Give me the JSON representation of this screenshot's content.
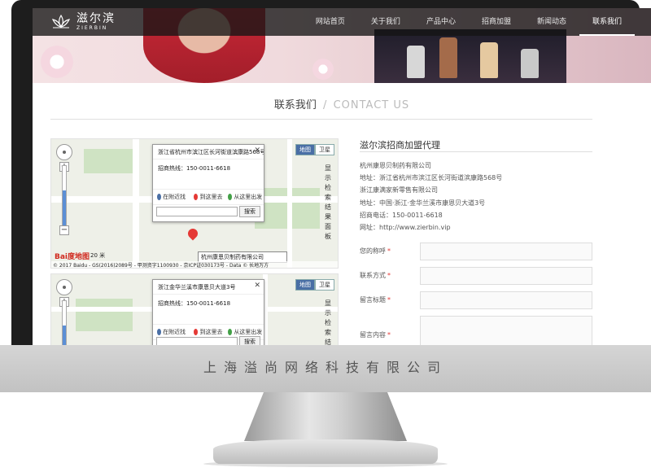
{
  "brand": {
    "name_cn": "滋尔滨",
    "name_en": "ZIERBIN"
  },
  "nav": {
    "items": [
      {
        "label": "网站首页"
      },
      {
        "label": "关于我们"
      },
      {
        "label": "产品中心"
      },
      {
        "label": "招商加盟"
      },
      {
        "label": "新闻动态"
      },
      {
        "label": "联系我们"
      }
    ],
    "active_index": 5
  },
  "section": {
    "title_cn": "联系我们",
    "separator": "/",
    "title_en": "CONTACT US"
  },
  "maps": [
    {
      "address": "浙江省杭州市滨江区长河街道滨康路568号",
      "tel": "招商热线：150-0011-6618",
      "actions": [
        "在附近找",
        "到这里去",
        "从这里出发"
      ],
      "search_button": "搜索",
      "map_types": [
        "地图",
        "卫星"
      ],
      "result_vertical": "显示检索结果面板",
      "pin_label": "杭州康恩贝制药有限公司",
      "baidu_logo": "Bai度地图",
      "scale": "20 米",
      "copyright": "© 2017 Baidu - GS(2016)2089号 - 甲测资字1100930 - 京ICP证030173号 - Data © 长地万方",
      "zoom_level": 0.6
    },
    {
      "address": "浙江金华兰溪市康恩贝大道3号",
      "tel": "招商热线：150-0011-6618",
      "actions": [
        "在附近找",
        "到这里去",
        "从这里出发"
      ],
      "search_button": "搜索",
      "map_types": [
        "地图",
        "卫星"
      ],
      "result_vertical": "显示检索结果",
      "zoom_level": 0.6
    }
  ],
  "agent": {
    "title": "滋尔滨招商加盟代理",
    "lines": [
      "杭州康恩贝制药有限公司",
      "地址：浙江省杭州市滨江区长河街道滨康路568号",
      "浙江康满家新零售有限公司",
      "地址：中国·浙江·金华兰溪市康恩贝大道3号",
      "招商电话：150-0011-6618",
      "网址：http://www.zierbin.vip"
    ]
  },
  "form": {
    "fields": [
      {
        "label": "您的称呼",
        "required_mark": "*"
      },
      {
        "label": "联系方式",
        "required_mark": "*"
      },
      {
        "label": "留言标题",
        "required_mark": "*"
      },
      {
        "label": "留言内容",
        "required_mark": "*"
      }
    ]
  },
  "footer": {
    "company": "上海溢尚网络科技有限公司"
  },
  "colors": {
    "nav_bg": "#141414",
    "accent_red": "#e53935",
    "map_blue": "#4a6fa5"
  }
}
